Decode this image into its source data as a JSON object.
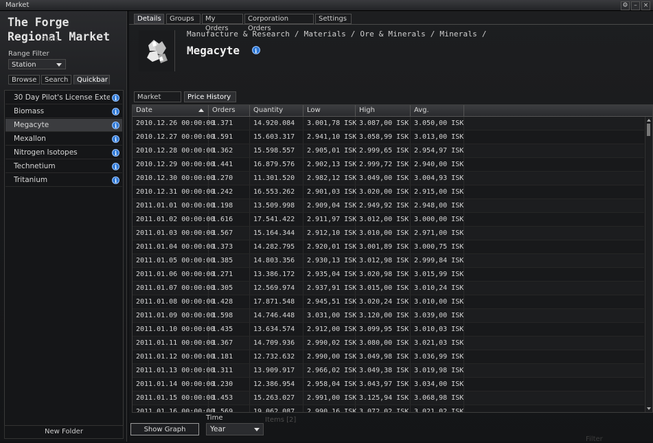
{
  "window": {
    "title": "Market",
    "controls": [
      "⚙",
      "–",
      "×"
    ]
  },
  "left": {
    "market_title": "The Forge Regional Market",
    "ghost_text": "Plant",
    "range_filter_label": "Range Filter",
    "range_filter_value": "Station",
    "tabs": [
      "Browse",
      "Search",
      "Quickbar"
    ],
    "active_tab": "Quickbar",
    "items": [
      {
        "label": "30 Day Pilot's License Exte"
      },
      {
        "label": "Biomass"
      },
      {
        "label": "Megacyte",
        "selected": true
      },
      {
        "label": "Mexallon"
      },
      {
        "label": "Nitrogen Isotopes"
      },
      {
        "label": "Technetium"
      },
      {
        "label": "Tritanium"
      }
    ],
    "new_folder_label": "New Folder"
  },
  "top_tabs": [
    "Details",
    "Groups",
    "My Orders",
    "Corporation Orders",
    "Settings"
  ],
  "active_top_tab": "Details",
  "item": {
    "breadcrumb": "Manufacture & Research / Materials / Ore & Minerals / Minerals /",
    "name": "Megacyte"
  },
  "sub_tabs": [
    "Market Data",
    "Price History"
  ],
  "active_sub_tab": "Price History",
  "table": {
    "columns": [
      "Date",
      "Orders",
      "Quantity",
      "Low",
      "High",
      "Avg."
    ],
    "rows": [
      [
        "2010.12.26 00:00:00",
        "1.371",
        "14.920.084",
        "3.001,78 ISK",
        "3.087,00 ISK",
        "3.050,00 ISK"
      ],
      [
        "2010.12.27 00:00:00",
        "1.591",
        "15.603.317",
        "2.941,10 ISK",
        "3.058,99 ISK",
        "3.013,00 ISK"
      ],
      [
        "2010.12.28 00:00:00",
        "1.362",
        "15.598.557",
        "2.905,01 ISK",
        "2.999,65 ISK",
        "2.954,97 ISK"
      ],
      [
        "2010.12.29 00:00:00",
        "1.441",
        "16.879.576",
        "2.902,13 ISK",
        "2.999,72 ISK",
        "2.940,00 ISK"
      ],
      [
        "2010.12.30 00:00:00",
        "1.270",
        "11.301.520",
        "2.982,12 ISK",
        "3.049,00 ISK",
        "3.004,93 ISK"
      ],
      [
        "2010.12.31 00:00:00",
        "1.242",
        "16.553.262",
        "2.901,03 ISK",
        "3.020,00 ISK",
        "2.915,00 ISK"
      ],
      [
        "2011.01.01 00:00:00",
        "1.198",
        "13.509.998",
        "2.909,04 ISK",
        "2.949,92 ISK",
        "2.948,00 ISK"
      ],
      [
        "2011.01.02 00:00:00",
        "1.616",
        "17.541.422",
        "2.911,97 ISK",
        "3.012,00 ISK",
        "3.000,00 ISK"
      ],
      [
        "2011.01.03 00:00:00",
        "1.567",
        "15.164.344",
        "2.912,10 ISK",
        "3.010,00 ISK",
        "2.971,00 ISK"
      ],
      [
        "2011.01.04 00:00:00",
        "1.373",
        "14.282.795",
        "2.920,01 ISK",
        "3.001,89 ISK",
        "3.000,75 ISK"
      ],
      [
        "2011.01.05 00:00:00",
        "1.385",
        "14.803.356",
        "2.930,13 ISK",
        "3.012,98 ISK",
        "2.999,84 ISK"
      ],
      [
        "2011.01.06 00:00:00",
        "1.271",
        "13.386.172",
        "2.935,04 ISK",
        "3.020,98 ISK",
        "3.015,99 ISK"
      ],
      [
        "2011.01.07 00:00:00",
        "1.305",
        "12.569.974",
        "2.937,91 ISK",
        "3.015,00 ISK",
        "3.010,24 ISK"
      ],
      [
        "2011.01.08 00:00:00",
        "1.428",
        "17.871.548",
        "2.945,51 ISK",
        "3.020,24 ISK",
        "3.010,00 ISK"
      ],
      [
        "2011.01.09 00:00:00",
        "1.598",
        "14.746.448",
        "3.031,00 ISK",
        "3.120,00 ISK",
        "3.039,00 ISK"
      ],
      [
        "2011.01.10 00:00:00",
        "1.435",
        "13.634.574",
        "2.912,00 ISK",
        "3.099,95 ISK",
        "3.010,03 ISK"
      ],
      [
        "2011.01.11 00:00:00",
        "1.367",
        "14.709.936",
        "2.990,02 ISK",
        "3.080,00 ISK",
        "3.021,03 ISK"
      ],
      [
        "2011.01.12 00:00:00",
        "1.181",
        "12.732.632",
        "2.990,00 ISK",
        "3.049,98 ISK",
        "3.036,99 ISK"
      ],
      [
        "2011.01.13 00:00:00",
        "1.311",
        "13.909.917",
        "2.966,02 ISK",
        "3.049,38 ISK",
        "3.019,98 ISK"
      ],
      [
        "2011.01.14 00:00:00",
        "1.230",
        "12.386.954",
        "2.958,04 ISK",
        "3.043,97 ISK",
        "3.034,00 ISK"
      ],
      [
        "2011.01.15 00:00:00",
        "1.453",
        "15.263.027",
        "2.991,00 ISK",
        "3.125,94 ISK",
        "3.068,98 ISK"
      ],
      [
        "2011.01.16 00:00:00",
        "1.569",
        "19.062.087",
        "2.990,16 ISK",
        "3.072,02 ISK",
        "3.021,02 ISK"
      ]
    ]
  },
  "bottom": {
    "show_graph_label": "Show Graph",
    "time_label": "Time",
    "time_value": "Year",
    "items_ghost": "Items [2]",
    "filter_ghost": "Filter"
  },
  "colors": {
    "info_icon": "#2e78d6",
    "selected_row": "#3b3c3f"
  }
}
